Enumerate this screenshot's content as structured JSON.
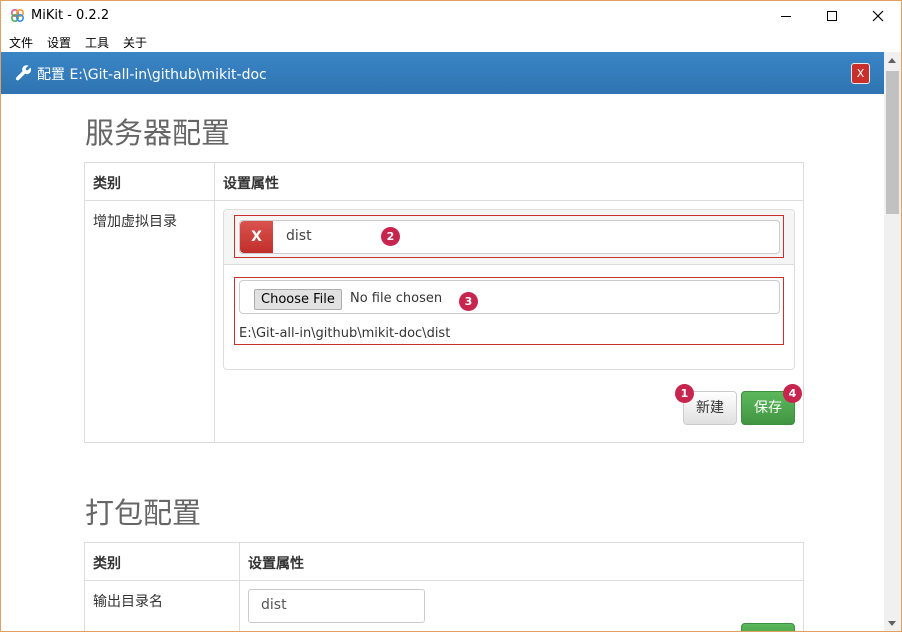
{
  "window": {
    "title": "MiKit - 0.2.2"
  },
  "menu": [
    "文件",
    "设置",
    "工具",
    "关于"
  ],
  "header": {
    "title": "配置 E:\\Git-all-in\\github\\mikit-doc",
    "close_label": "X"
  },
  "server_config": {
    "title": "服务器配置",
    "col_category": "类别",
    "col_settings": "设置属性",
    "row_label": "增加虚拟目录",
    "entry": {
      "remove_label": "X",
      "name": "dist",
      "choose_file_label": "Choose File",
      "no_file_text": "No file chosen",
      "path": "E:\\Git-all-in\\github\\mikit-doc\\dist"
    },
    "new_label": "新建",
    "save_label": "保存",
    "badges": [
      "1",
      "2",
      "3",
      "4"
    ]
  },
  "pack_config": {
    "title": "打包配置",
    "col_category": "类别",
    "col_settings": "设置属性",
    "row_label": "输出目录名",
    "output_dir_value": "dist"
  },
  "colors": {
    "header_blue": "#337ab7",
    "danger_red": "#c9302c",
    "success_green": "#5cb85c",
    "badge": "#c7254e"
  }
}
